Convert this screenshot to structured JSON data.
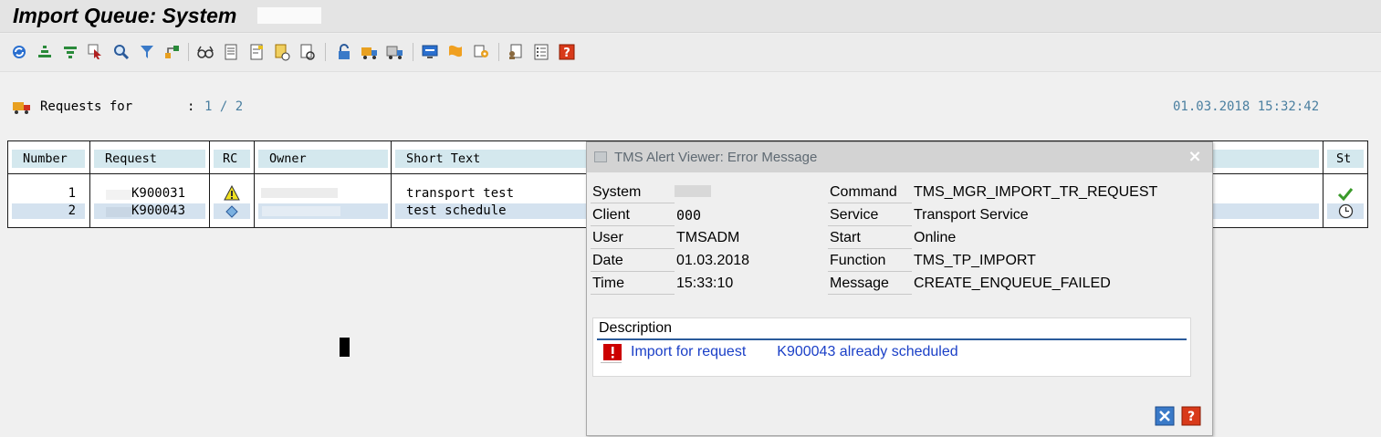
{
  "header": {
    "title": "Import Queue: System"
  },
  "toolbar": {
    "icons": [
      "refresh-icon",
      "collapse-icon",
      "filter-settings-icon",
      "select-icon",
      "zoom-icon",
      "filter-icon",
      "tree-icon",
      "glasses-icon",
      "document-icon",
      "document-edit-icon",
      "log-icon",
      "log-view-icon",
      "lock-icon",
      "truck-icon",
      "truck-all-icon",
      "monitor-icon",
      "alert-icon",
      "settings-icon",
      "doc-person-icon",
      "list-icon",
      "help-icon"
    ]
  },
  "info": {
    "requests_label": "Requests for",
    "colon": ":",
    "count": "1 / 2",
    "datetime": "01.03.2018 15:32:42"
  },
  "table": {
    "headers": {
      "number": "Number",
      "request": "Request",
      "rc": "RC",
      "owner": "Owner",
      "short_text": "Short Text",
      "st": "St"
    },
    "rows": [
      {
        "number": "1",
        "request": "K900031",
        "rc_icon": "warning-icon",
        "short_text": "transport test",
        "st_icon": "checkmark-icon"
      },
      {
        "number": "2",
        "request": "K900043",
        "rc_icon": "diamond-icon",
        "short_text": "test schedule",
        "st_icon": "clock-icon"
      }
    ]
  },
  "dialog": {
    "title": "TMS Alert Viewer: Error Message",
    "fields_left": [
      {
        "label": "System",
        "value": ""
      },
      {
        "label": "Client",
        "value": "000"
      },
      {
        "label": "User",
        "value": "TMSADM"
      },
      {
        "label": "Date",
        "value": "01.03.2018"
      },
      {
        "label": "Time",
        "value": "15:33:10"
      }
    ],
    "fields_right": [
      {
        "label": "Command",
        "value": "TMS_MGR_IMPORT_TR_REQUEST"
      },
      {
        "label": "Service",
        "value": "Transport Service"
      },
      {
        "label": "Start",
        "value": "Online"
      },
      {
        "label": "Function",
        "value": "TMS_TP_IMPORT"
      },
      {
        "label": "Message",
        "value": "CREATE_ENQUEUE_FAILED"
      }
    ],
    "description": {
      "heading": "Description",
      "msg_prefix": "Import for request",
      "msg_suffix": "K900043 already scheduled"
    }
  },
  "colors": {
    "header_cell": "#d4e8ee",
    "selected_row": "#d4e2ef",
    "link_blue": "#1a3fc7",
    "info_blue": "#4a7fa0",
    "error_red": "#cc0000"
  }
}
